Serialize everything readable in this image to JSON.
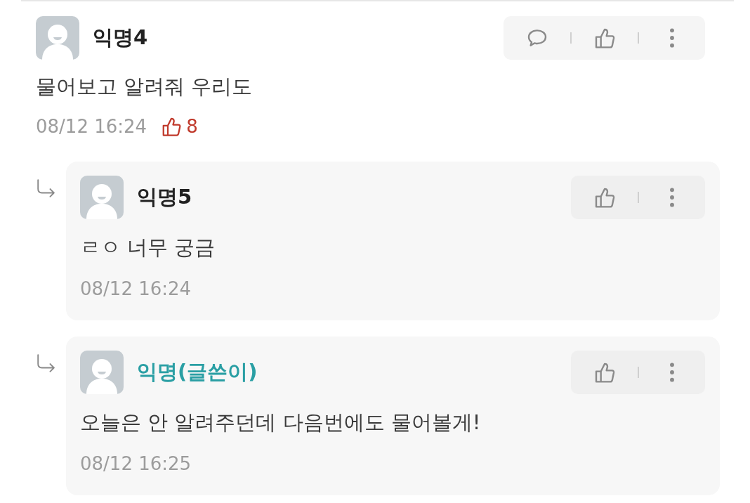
{
  "comments": [
    {
      "author": "익명4",
      "is_writer": false,
      "text": "물어보고 알려줘 우리도",
      "time": "08/12 16:24",
      "likes": "8",
      "actions": [
        {
          "kind": "comment"
        },
        {
          "kind": "like"
        },
        {
          "kind": "more"
        }
      ],
      "replies": [
        {
          "author": "익명5",
          "is_writer": false,
          "text": "ㄹㅇ 너무 궁금",
          "time": "08/12 16:24",
          "actions": [
            {
              "kind": "like"
            },
            {
              "kind": "more"
            }
          ]
        },
        {
          "author": "익명(글쓴이)",
          "is_writer": true,
          "text": "오늘은 안 알려주던데 다음번에도 물어볼게!",
          "time": "08/12 16:25",
          "actions": [
            {
              "kind": "like"
            },
            {
              "kind": "more"
            }
          ]
        }
      ]
    }
  ]
}
